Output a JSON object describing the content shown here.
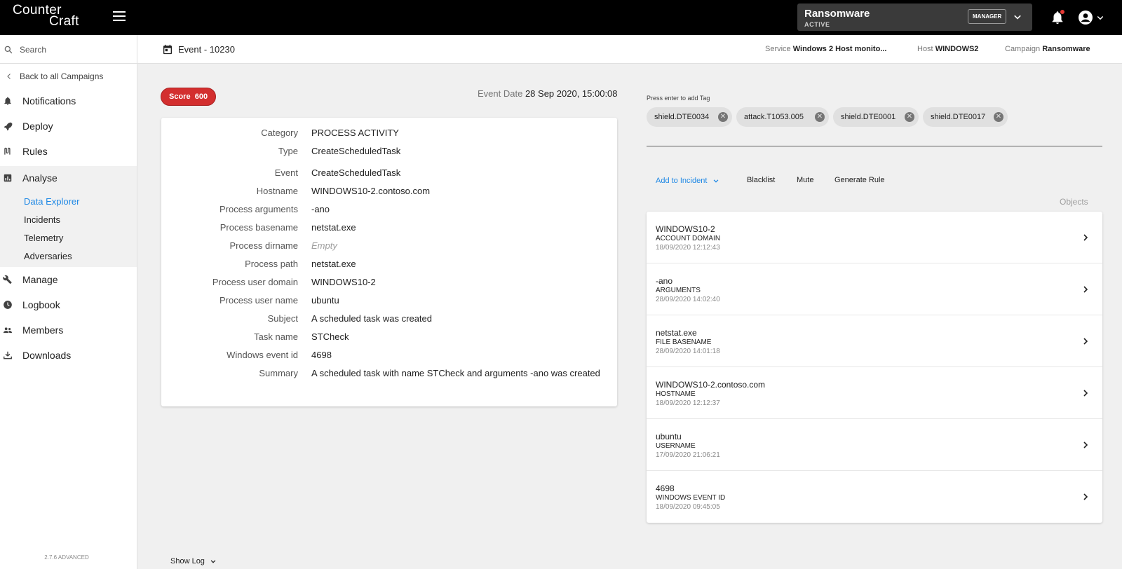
{
  "topbar": {
    "logo_line1": "Counter",
    "logo_line2": "Craft",
    "campaign_name": "Ransomware",
    "campaign_status": "ACTIVE",
    "role": "MANAGER"
  },
  "sidebar": {
    "search_placeholder": "Search",
    "back_label": "Back to all Campaigns",
    "items": [
      {
        "label": "Notifications",
        "icon": "bell-icon"
      },
      {
        "label": "Deploy",
        "icon": "rocket-icon"
      },
      {
        "label": "Rules",
        "icon": "rules-icon"
      },
      {
        "label": "Analyse",
        "icon": "chart-icon"
      },
      {
        "label": "Manage",
        "icon": "wrench-icon"
      },
      {
        "label": "Logbook",
        "icon": "clock-icon"
      },
      {
        "label": "Members",
        "icon": "people-icon"
      },
      {
        "label": "Downloads",
        "icon": "download-icon"
      }
    ],
    "analyse_sub": [
      "Data Explorer",
      "Incidents",
      "Telemetry",
      "Adversaries"
    ],
    "active_sub": "Data Explorer",
    "version": "2.7.6 ADVANCED"
  },
  "header": {
    "title": "Event - 10230",
    "service_label": "Service",
    "service_value": "Windows 2 Host monito...",
    "host_label": "Host",
    "host_value": "WINDOWS2",
    "campaign_label": "Campaign",
    "campaign_value": "Ransomware"
  },
  "event": {
    "score_label": "Score",
    "score_value": "600",
    "date_label": "Event Date",
    "date_value": "28 Sep 2020, 15:00:08",
    "fields": [
      {
        "key": "Category",
        "value": "PROCESS ACTIVITY"
      },
      {
        "key": "Type",
        "value": "CreateScheduledTask"
      },
      {
        "key": "Event",
        "value": "CreateScheduledTask"
      },
      {
        "key": "Hostname",
        "value": "WINDOWS10-2.contoso.com"
      },
      {
        "key": "Process arguments",
        "value": "-ano"
      },
      {
        "key": "Process basename",
        "value": "netstat.exe"
      },
      {
        "key": "Process dirname",
        "value": "Empty"
      },
      {
        "key": "Process path",
        "value": "netstat.exe"
      },
      {
        "key": "Process user domain",
        "value": "WINDOWS10-2"
      },
      {
        "key": "Process user name",
        "value": "ubuntu"
      },
      {
        "key": "Subject",
        "value": "A scheduled task was created"
      },
      {
        "key": "Task name",
        "value": "STCheck"
      },
      {
        "key": "Windows event id",
        "value": "4698"
      },
      {
        "key": "Summary",
        "value": "A scheduled task with name STCheck and arguments -ano was created"
      }
    ],
    "show_log": "Show Log"
  },
  "tags": {
    "hint": "Press enter to add Tag",
    "items": [
      "shield.DTE0034",
      "attack.T1053.005",
      "shield.DTE0001",
      "shield.DTE0017"
    ]
  },
  "actions": {
    "add_to_incident": "Add to Incident",
    "blacklist": "Blacklist",
    "mute": "Mute",
    "generate_rule": "Generate Rule"
  },
  "objects": {
    "label": "Objects",
    "items": [
      {
        "value": "WINDOWS10-2",
        "type": "ACCOUNT DOMAIN",
        "date": "18/09/2020 12:12:43"
      },
      {
        "value": "-ano",
        "type": "ARGUMENTS",
        "date": "28/09/2020 14:02:40"
      },
      {
        "value": "netstat.exe",
        "type": "FILE BASENAME",
        "date": "28/09/2020 14:01:18"
      },
      {
        "value": "WINDOWS10-2.contoso.com",
        "type": "HOSTNAME",
        "date": "18/09/2020 12:12:37"
      },
      {
        "value": "ubuntu",
        "type": "USERNAME",
        "date": "17/09/2020 21:06:21"
      },
      {
        "value": "4698",
        "type": "WINDOWS EVENT ID",
        "date": "18/09/2020 09:45:05"
      }
    ]
  }
}
